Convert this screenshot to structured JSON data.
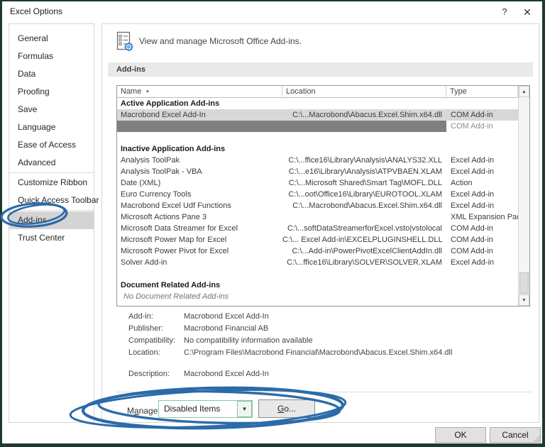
{
  "window": {
    "title": "Excel Options",
    "help_glyph": "?",
    "close_glyph": "✕"
  },
  "icons": {
    "sort_asc": "▲",
    "scroll_up": "▲",
    "scroll_down": "▼",
    "dropdown_arrow": "▼"
  },
  "colors": {
    "annotation_blue": "#2B6BA8",
    "window_frame_green": "#1E3A2D",
    "selection_gray": "#D8D8D8",
    "redaction_gray": "#7F7F7F",
    "dropdown_focus_green": "#8FC7A0"
  },
  "sidebar": {
    "items": [
      {
        "label": "General"
      },
      {
        "label": "Formulas"
      },
      {
        "label": "Data"
      },
      {
        "label": "Proofing"
      },
      {
        "label": "Save"
      },
      {
        "label": "Language"
      },
      {
        "label": "Ease of Access"
      },
      {
        "label": "Advanced"
      },
      {
        "label": "Customize Ribbon"
      },
      {
        "label": "Quick Access Toolbar"
      },
      {
        "label": "Add-ins",
        "selected": true
      },
      {
        "label": "Trust Center"
      }
    ]
  },
  "main": {
    "header_text": "View and manage Microsoft Office Add-ins.",
    "section_title": "Add-ins",
    "table": {
      "columns": [
        "Name",
        "Location",
        "Type"
      ],
      "rows": [
        {
          "kind": "group",
          "name": "Active Application Add-ins"
        },
        {
          "kind": "row",
          "name": "Macrobond Excel Add-In",
          "location": "C:\\...Macrobond\\Abacus.Excel.Shim.x64.dll",
          "type": "COM Add-in",
          "selected": true
        },
        {
          "kind": "redacted",
          "type": "COM Add-in"
        },
        {
          "kind": "blank"
        },
        {
          "kind": "group",
          "name": "Inactive Application Add-ins"
        },
        {
          "kind": "row",
          "name": "Analysis ToolPak",
          "location": "C:\\...ffice16\\Library\\Analysis\\ANALYS32.XLL",
          "type": "Excel Add-in"
        },
        {
          "kind": "row",
          "name": "Analysis ToolPak - VBA",
          "location": "C:\\...e16\\Library\\Analysis\\ATPVBAEN.XLAM",
          "type": "Excel Add-in"
        },
        {
          "kind": "row",
          "name": "Date (XML)",
          "location": "C:\\...Microsoft Shared\\Smart Tag\\MOFL.DLL",
          "type": "Action"
        },
        {
          "kind": "row",
          "name": "Euro Currency Tools",
          "location": "C:\\...oot\\Office16\\Library\\EUROTOOL.XLAM",
          "type": "Excel Add-in"
        },
        {
          "kind": "row",
          "name": "Macrobond Excel Udf Functions",
          "location": "C:\\...Macrobond\\Abacus.Excel.Shim.x64.dll",
          "type": "Excel Add-in"
        },
        {
          "kind": "row",
          "name": "Microsoft Actions Pane 3",
          "location": "",
          "type": "XML Expansion Pack"
        },
        {
          "kind": "row",
          "name": "Microsoft Data Streamer for Excel",
          "location": "C:\\...softDataStreamerforExcel.vsto|vstolocal",
          "type": "COM Add-in"
        },
        {
          "kind": "row",
          "name": "Microsoft Power Map for Excel",
          "location": "C:\\... Excel Add-in\\EXCELPLUGINSHELL.DLL",
          "type": "COM Add-in"
        },
        {
          "kind": "row",
          "name": "Microsoft Power Pivot for Excel",
          "location": "C:\\...Add-in\\PowerPivotExcelClientAddIn.dll",
          "type": "COM Add-in"
        },
        {
          "kind": "row",
          "name": "Solver Add-in",
          "location": "C:\\...ffice16\\Library\\SOLVER\\SOLVER.XLAM",
          "type": "Excel Add-in"
        },
        {
          "kind": "blank"
        },
        {
          "kind": "group",
          "name": "Document Related Add-ins"
        },
        {
          "kind": "note",
          "name": "No Document Related Add-ins"
        }
      ]
    },
    "details": {
      "rows": [
        {
          "label": "Add-in:",
          "value": "Macrobond Excel Add-In"
        },
        {
          "label": "Publisher:",
          "value": "Macrobond Financial AB"
        },
        {
          "label": "Compatibility:",
          "value": "No compatibility information available"
        },
        {
          "label": "Location:",
          "value": "C:\\Program Files\\Macrobond Financial\\Macrobond\\Abacus.Excel.Shim.x64.dll"
        }
      ],
      "description": {
        "label": "Description:",
        "value": "Macrobond Excel Add-In"
      }
    },
    "manage": {
      "label_parts": [
        "M",
        "a",
        "nage:"
      ],
      "value": "Disabled Items",
      "go_parts": [
        "G",
        "o..."
      ]
    }
  },
  "footer": {
    "ok": "OK",
    "cancel": "Cancel"
  },
  "annotations": {
    "highlight_1": "hand-drawn blue circle around Add-ins sidebar item",
    "highlight_2": "hand-drawn blue circle around Manage dropdown and Go button"
  }
}
